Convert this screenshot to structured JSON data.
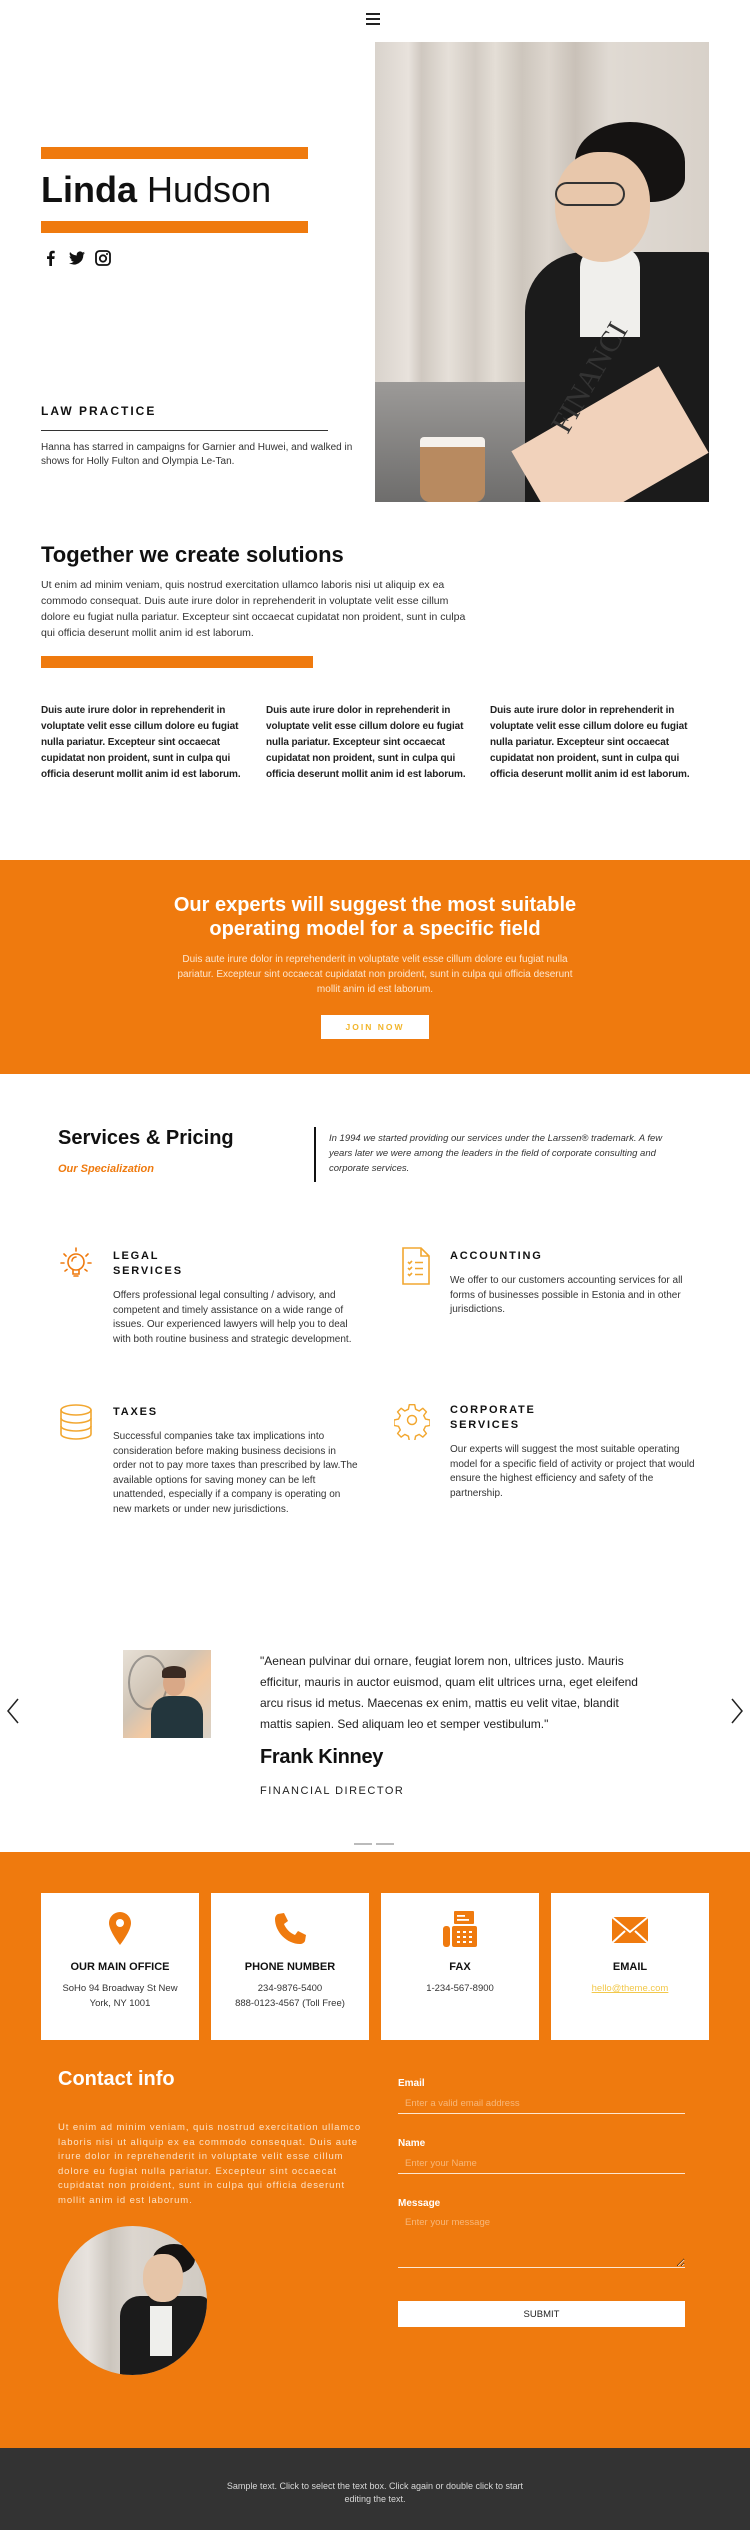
{
  "header": {
    "menu_icon": "hamburger-icon"
  },
  "hero": {
    "first_name": "Linda",
    "last_name": " Hudson",
    "social": [
      "facebook-icon",
      "twitter-icon",
      "instagram-icon"
    ],
    "section_label": "LAW PRACTICE",
    "bio": "Hanna has starred in campaigns for Garnier and Huwei, and walked in shows for Holly Fulton and Olympia Le-Tan.",
    "photo_caption": "FINANCI"
  },
  "solutions": {
    "title": "Together we create solutions",
    "text": "Ut enim ad minim veniam, quis nostrud exercitation ullamco laboris nisi ut aliquip ex ea commodo consequat. Duis aute irure dolor in reprehenderit in voluptate velit esse cillum dolore eu fugiat nulla pariatur. Excepteur sint occaecat cupidatat non proident, sunt in culpa qui officia deserunt mollit anim id est laborum.",
    "columns": [
      "Duis aute irure dolor in reprehenderit in voluptate velit esse cillum dolore eu fugiat nulla pariatur. Excepteur sint occaecat cupidatat non proident, sunt in culpa qui officia deserunt mollit anim id est laborum.",
      "Duis aute irure dolor in reprehenderit in voluptate velit esse cillum dolore eu fugiat nulla pariatur. Excepteur sint occaecat cupidatat non proident, sunt in culpa qui officia deserunt mollit anim id est laborum.",
      "Duis aute irure dolor in reprehenderit in voluptate velit esse cillum dolore eu fugiat nulla pariatur. Excepteur sint occaecat cupidatat non proident, sunt in culpa qui officia deserunt mollit anim id est laborum."
    ]
  },
  "cta": {
    "title": "Our experts will suggest the most suitable operating model for a specific field",
    "text": "Duis aute irure dolor in reprehenderit in voluptate velit esse cillum dolore eu fugiat nulla pariatur. Excepteur sint occaecat cupidatat non proident, sunt in culpa qui officia deserunt mollit anim id est laborum.",
    "button": "JOIN NOW"
  },
  "services": {
    "title": "Services & Pricing",
    "subtitle": "Our Specialization",
    "quote": "In 1994 we started providing our services under the Larssen® trademark. A few years later we were among the leaders in the field of corporate consulting and corporate services.",
    "items": [
      {
        "icon": "lightbulb-icon",
        "title_1": "LEGAL",
        "title_2": "SERVICES",
        "text": "Offers professional legal consulting / advisory, and competent and timely assistance on a wide range of issues. Our experienced lawyers will help you to deal with both routine business and strategic development."
      },
      {
        "icon": "checklist-document-icon",
        "title_1": "ACCOUNTING",
        "title_2": "",
        "text": "We offer to our customers accounting services for all forms of businesses possible in Estonia and in other jurisdictions."
      },
      {
        "icon": "coin-stack-icon",
        "title_1": "TAXES",
        "title_2": "",
        "text": "Successful companies take tax implications into consideration before making business decisions in order not to pay more taxes than prescribed by law.The available options for saving money can be left unattended, especially if a company is operating on new markets or under new jurisdictions."
      },
      {
        "icon": "gear-icon",
        "title_1": "CORPORATE",
        "title_2": "SERVICES",
        "text": "Our experts will suggest the most suitable operating model for a specific field of activity or project that would ensure the highest efficiency and safety of the partnership."
      }
    ]
  },
  "testimonial": {
    "quote": "\"Aenean pulvinar dui ornare, feugiat lorem non, ultrices justo. Mauris efficitur, mauris in auctor euismod, quam elit ultrices urna, eget eleifend arcu risus id metus. Maecenas ex enim, mattis eu velit vitae, blandit mattis sapien. Sed aliquam leo et semper vestibulum.\"",
    "name": "Frank Kinney",
    "role": "FINANCIAL DIRECTOR",
    "slide_count": 2,
    "active_slide": 1
  },
  "contact": {
    "cards": [
      {
        "icon": "map-pin-icon",
        "title": "OUR MAIN OFFICE",
        "value": "SoHo 94 Broadway St New York, NY 1001"
      },
      {
        "icon": "phone-icon",
        "title": "PHONE NUMBER",
        "value": "234-9876-5400\n888-0123-4567 (Toll Free)"
      },
      {
        "icon": "fax-icon",
        "title": "FAX",
        "value": "1-234-567-8900"
      },
      {
        "icon": "envelope-icon",
        "title": "EMAIL",
        "value": "hello@theme.com"
      }
    ],
    "title": "Contact info",
    "text": "Ut enim ad minim veniam, quis nostrud exercitation ullamco laboris nisi ut aliquip ex ea commodo consequat. Duis aute irure dolor in reprehenderit in voluptate velit esse cillum dolore eu fugiat nulla pariatur. Excepteur sint occaecat cupidatat non proident, sunt in culpa qui officia deserunt mollit anim id est laborum.",
    "form": {
      "email_label": "Email",
      "email_placeholder": "Enter a valid email address",
      "name_label": "Name",
      "name_placeholder": "Enter your Name",
      "message_label": "Message",
      "message_placeholder": "Enter your message",
      "submit": "SUBMIT"
    }
  },
  "footer": {
    "text": "Sample text. Click to select the text box. Click again or double click to start editing the text."
  },
  "colors": {
    "accent": "#ef7a0e",
    "link": "#f2c84a",
    "footer_bg": "#333333"
  }
}
